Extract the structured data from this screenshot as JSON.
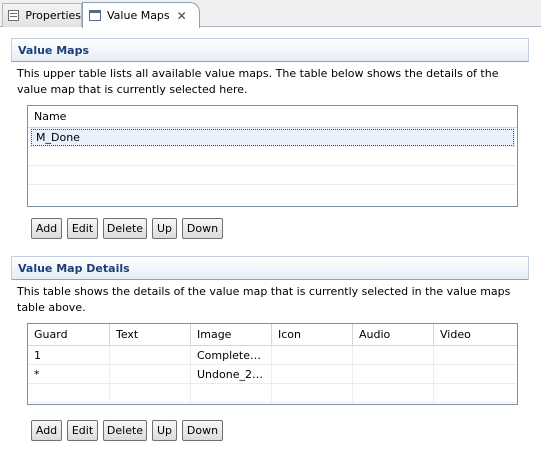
{
  "tabs": [
    {
      "label": "Properties",
      "icon": "properties-icon"
    },
    {
      "label": "Value Maps",
      "icon": "value-maps-icon",
      "active": true
    }
  ],
  "value_maps": {
    "title": "Value Maps",
    "description": "This upper table lists all available value maps. The table below shows the details of the value map that is currently selected here.",
    "columns": [
      "Name"
    ],
    "rows": [
      [
        "M_Done"
      ]
    ],
    "selected_row": 0,
    "buttons": {
      "add": "Add",
      "edit": "Edit",
      "delete": "Delete",
      "up": "Up",
      "down": "Down"
    }
  },
  "details": {
    "title": "Value Map Details",
    "description": "This table shows the details of the value map that is currently selected in the value maps table above.",
    "columns": [
      "Guard",
      "Text",
      "Image",
      "Icon",
      "Audio",
      "Video"
    ],
    "rows": [
      [
        "1",
        "",
        "Complete…",
        "",
        "",
        ""
      ],
      [
        "*",
        "",
        "Undone_2…",
        "",
        "",
        ""
      ]
    ],
    "buttons": {
      "add": "Add",
      "edit": "Edit",
      "delete": "Delete",
      "up": "Up",
      "down": "Down"
    }
  }
}
